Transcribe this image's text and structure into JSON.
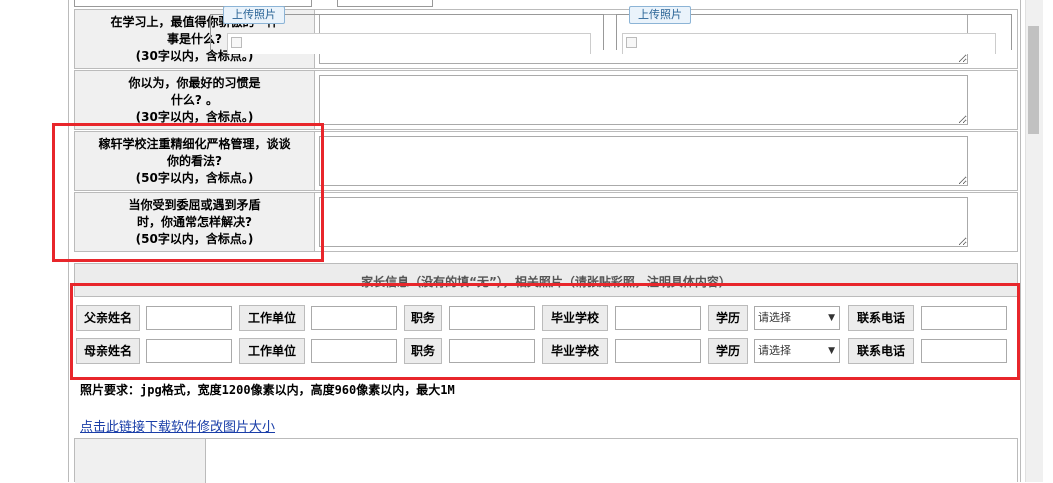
{
  "questions": [
    {
      "label": "在学习上，最值得你骄傲的一件\n事是什么?\n(30字以内，含标点。)"
    },
    {
      "label": "你以为，你最好的习惯是\n什么? 。\n(30字以内，含标点。)"
    },
    {
      "label": "稼轩学校注重精细化严格管理，谈谈\n你的看法?\n(50字以内，含标点。)"
    },
    {
      "label": "当你受到委屈或遇到矛盾\n时，你通常怎样解决?\n(50字以内，含标点。)"
    }
  ],
  "parents": {
    "section_title": "家长信息（没有的填“无”），相关照片（请张贴彩照，注明具体内容）",
    "rows": [
      {
        "name_label": "父亲姓名",
        "work_label": "工作单位",
        "position_label": "职务",
        "school_label": "毕业学校",
        "edu_label": "学历",
        "edu_value": "请选择",
        "phone_label": "联系电话"
      },
      {
        "name_label": "母亲姓名",
        "work_label": "工作单位",
        "position_label": "职务",
        "school_label": "毕业学校",
        "edu_label": "学历",
        "edu_value": "请选择",
        "phone_label": "联系电话"
      }
    ]
  },
  "photo": {
    "requirement": "照片要求：jpg格式，宽度1200像素以内，高度960像素以内，最大1M",
    "download_link": "点击此链接下载软件修改图片大小",
    "upload_label_1": "上传照片",
    "upload_label_2": "上传照片"
  },
  "colors": {
    "highlight": "#e8262b",
    "link": "#1a3ea8"
  }
}
